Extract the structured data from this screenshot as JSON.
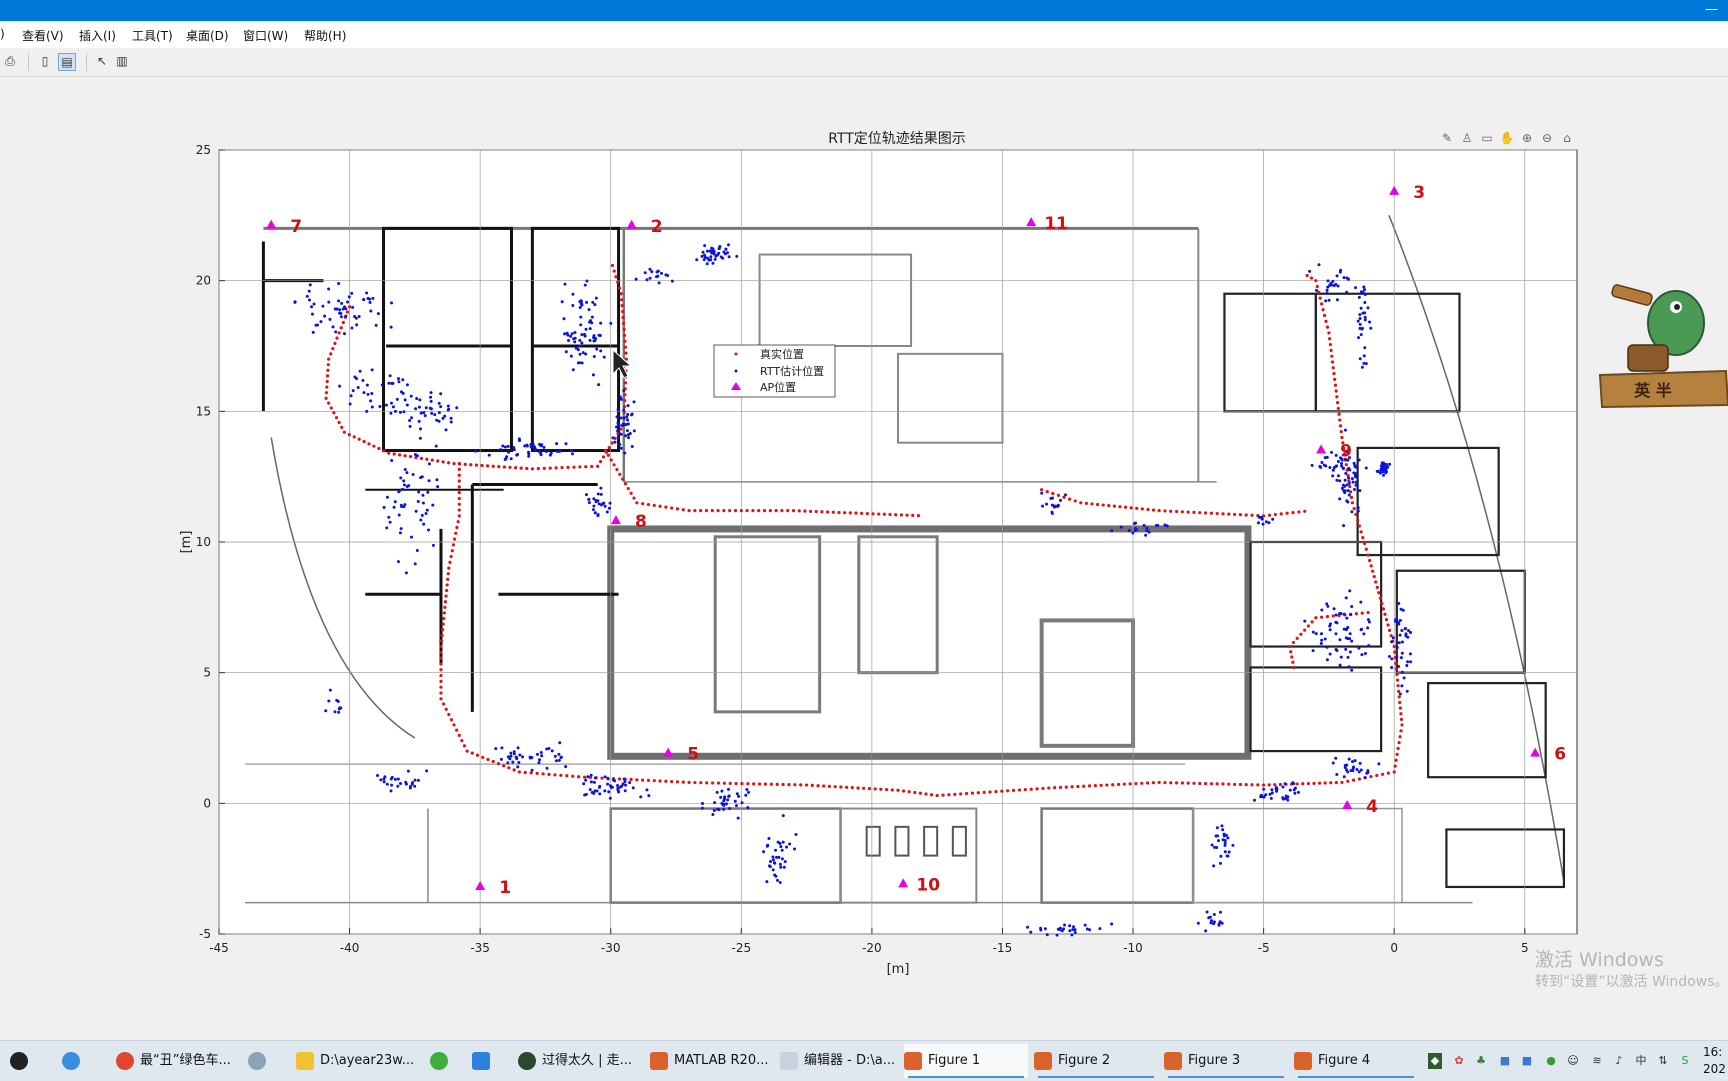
{
  "window": {
    "controls": "—"
  },
  "menu": {
    "items": [
      ")",
      "查看(V)",
      "插入(I)",
      "工具(T)",
      "桌面(D)",
      "窗口(W)",
      "帮助(H)"
    ]
  },
  "colors": {
    "title_bar": "#0078d7",
    "real": "#dc1414",
    "rtt": "#0a14dc",
    "ap": "#e600e6",
    "ap_label": "#d01010"
  },
  "chart_data": {
    "type": "scatter",
    "title": "RTT定位轨迹结果图示",
    "xlabel": "[m]",
    "ylabel": "[m]",
    "xlim": [
      -45,
      7
    ],
    "ylim": [
      -5,
      25
    ],
    "xticks": [
      -45,
      -40,
      -35,
      -30,
      -25,
      -20,
      -15,
      -10,
      -5,
      0,
      5
    ],
    "yticks": [
      -5,
      0,
      5,
      10,
      15,
      20,
      25
    ],
    "grid": true,
    "background": "floor plan",
    "legend": {
      "placement": "upper-center",
      "entries": [
        "真实位置",
        "RTT估计位置",
        "AP位置"
      ]
    },
    "series": [
      {
        "name": "真实位置",
        "marker": "dot",
        "color": "#dc1414",
        "paths": [
          [
            [
              -40.0,
              19.0
            ],
            [
              -40.8,
              17.0
            ],
            [
              -40.9,
              15.5
            ],
            [
              -40.2,
              14.2
            ],
            [
              -38.5,
              13.4
            ],
            [
              -36.0,
              13.0
            ],
            [
              -33.0,
              12.8
            ],
            [
              -30.5,
              12.9
            ],
            [
              -29.5,
              14.5
            ],
            [
              -29.4,
              17.0
            ],
            [
              -29.6,
              19.5
            ],
            [
              -30.0,
              20.8
            ]
          ],
          [
            [
              -35.8,
              13.0
            ],
            [
              -35.8,
              11.0
            ],
            [
              -36.2,
              9.0
            ],
            [
              -36.5,
              6.0
            ],
            [
              -36.5,
              4.0
            ],
            [
              -35.5,
              2.0
            ],
            [
              -33.5,
              1.2
            ],
            [
              -31.0,
              1.0
            ],
            [
              -27.0,
              0.8
            ],
            [
              -22.5,
              0.7
            ],
            [
              -19.0,
              0.5
            ],
            [
              -17.5,
              0.3
            ],
            [
              -13.0,
              0.6
            ],
            [
              -9.0,
              0.8
            ],
            [
              -5.0,
              0.7
            ],
            [
              -2.0,
              0.8
            ],
            [
              0.0,
              1.2
            ],
            [
              0.3,
              3.0
            ],
            [
              0.0,
              6.0
            ],
            [
              -1.0,
              9.5
            ],
            [
              -1.6,
              11.5
            ],
            [
              -2.0,
              14.0
            ],
            [
              -2.5,
              18.0
            ],
            [
              -3.0,
              20.0
            ],
            [
              -3.5,
              20.3
            ]
          ],
          [
            [
              -30.2,
              13.5
            ],
            [
              -29.0,
              11.5
            ],
            [
              -27.0,
              11.2
            ],
            [
              -23.0,
              11.2
            ],
            [
              -18.0,
              11.0
            ]
          ],
          [
            [
              -13.5,
              12.0
            ],
            [
              -12.0,
              11.5
            ],
            [
              -9.0,
              11.2
            ],
            [
              -5.0,
              11.0
            ],
            [
              -3.2,
              11.2
            ]
          ],
          [
            [
              -1.0,
              7.3
            ],
            [
              -3.0,
              7.1
            ],
            [
              -4.0,
              6.0
            ],
            [
              -3.8,
              5.0
            ]
          ]
        ]
      },
      {
        "name": "RTT估计位置",
        "marker": "dot",
        "color": "#0a14dc",
        "clusters": [
          [
            -40.5,
            19.0,
            2.5,
            1.2,
            55
          ],
          [
            -39.0,
            15.8,
            1.8,
            1.2,
            35
          ],
          [
            -37.0,
            15.0,
            1.6,
            1.2,
            40
          ],
          [
            -31.0,
            18.0,
            1.2,
            3.0,
            70
          ],
          [
            -29.5,
            14.5,
            0.6,
            1.8,
            40
          ],
          [
            -33.0,
            13.5,
            2.5,
            0.6,
            45
          ],
          [
            -37.6,
            11.5,
            1.4,
            3.5,
            55
          ],
          [
            -30.5,
            11.5,
            0.7,
            0.8,
            25
          ],
          [
            -26.0,
            21.0,
            1.0,
            0.5,
            40
          ],
          [
            -28.3,
            20.2,
            1.2,
            0.4,
            15
          ],
          [
            -33.0,
            1.8,
            2.0,
            0.7,
            40
          ],
          [
            -30.0,
            0.6,
            2.0,
            0.7,
            45
          ],
          [
            -25.5,
            0.0,
            1.2,
            0.8,
            35
          ],
          [
            -23.5,
            -2.0,
            0.9,
            1.8,
            35
          ],
          [
            -38.0,
            0.8,
            1.4,
            0.7,
            25
          ],
          [
            -40.5,
            4.0,
            0.6,
            0.8,
            10
          ],
          [
            -12.5,
            -4.8,
            2.0,
            0.3,
            25
          ],
          [
            -7.0,
            -4.5,
            1.0,
            0.6,
            15
          ],
          [
            -13.0,
            11.5,
            0.8,
            0.7,
            15
          ],
          [
            -9.5,
            10.5,
            2.0,
            0.4,
            18
          ],
          [
            -5.0,
            10.8,
            0.5,
            0.3,
            8
          ],
          [
            -1.7,
            12.5,
            0.9,
            2.2,
            55
          ],
          [
            -2.5,
            20.0,
            1.2,
            1.2,
            25
          ],
          [
            -1.2,
            18.5,
            0.5,
            2.5,
            30
          ],
          [
            -0.4,
            12.8,
            0.3,
            0.3,
            40
          ],
          [
            -2.5,
            13.0,
            1.0,
            0.5,
            15
          ],
          [
            -2.0,
            6.5,
            1.6,
            2.5,
            60
          ],
          [
            0.3,
            6.0,
            0.6,
            3.0,
            40
          ],
          [
            -4.5,
            0.4,
            1.4,
            0.6,
            30
          ],
          [
            -1.5,
            1.3,
            1.2,
            0.5,
            25
          ],
          [
            -6.6,
            -1.6,
            0.5,
            1.3,
            25
          ]
        ]
      },
      {
        "name": "AP位置",
        "marker": "triangle",
        "color": "#e600e6",
        "points": [
          {
            "x": -35.0,
            "y": -3.2,
            "label": "1"
          },
          {
            "x": -29.2,
            "y": 22.1,
            "label": "2"
          },
          {
            "x": 0.0,
            "y": 23.4,
            "label": "3"
          },
          {
            "x": -1.8,
            "y": -0.1,
            "label": "4"
          },
          {
            "x": -27.8,
            "y": 1.9,
            "label": "5"
          },
          {
            "x": 5.4,
            "y": 1.9,
            "label": "6"
          },
          {
            "x": -43.0,
            "y": 22.1,
            "label": "7"
          },
          {
            "x": -29.8,
            "y": 10.8,
            "label": "8"
          },
          {
            "x": -2.8,
            "y": 13.5,
            "label": "9"
          },
          {
            "x": -18.8,
            "y": -3.1,
            "label": "10"
          },
          {
            "x": -13.9,
            "y": 22.2,
            "label": "11"
          }
        ]
      }
    ]
  },
  "mascot": {
    "sign": "英 半"
  },
  "watermark": {
    "line1": "激活 Windows",
    "line2": "转到“设置”以激活 Windows。"
  },
  "taskbar": {
    "items": [
      "最“丑”绿色车...",
      "D:\\ayear23w...",
      "过得太久 | 走...",
      "MATLAB R20...",
      "编辑器 - D:\\a...",
      "Figure 1",
      "Figure 2",
      "Figure 3",
      "Figure 4"
    ],
    "active": "Figure 1",
    "clock": [
      "16:",
      "202"
    ]
  }
}
